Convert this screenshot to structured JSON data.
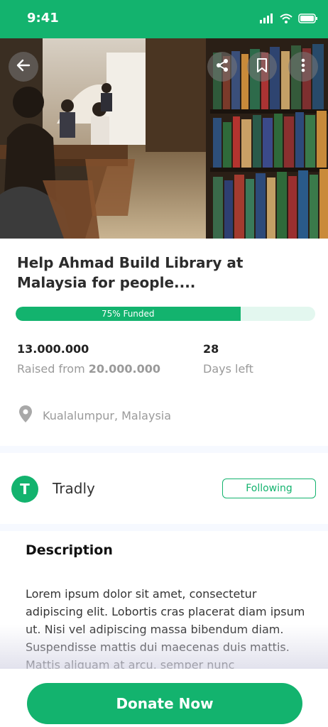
{
  "status_bar": {
    "time": "9:41"
  },
  "hero": {
    "back_icon": "arrow-left-icon",
    "share_icon": "share-icon",
    "bookmark_icon": "bookmark-icon",
    "more_icon": "more-vertical-icon"
  },
  "campaign": {
    "title": "Help Ahmad Build Library at Malaysia for people....",
    "progress_percent": 75,
    "progress_label": "75% Funded",
    "raised_amount": "13.000.000",
    "raised_from_prefix": "Raised from",
    "goal_amount": "20.000.000",
    "days_value": "28",
    "days_label": "Days left",
    "location": "Kualalumpur, Malaysia"
  },
  "seller": {
    "avatar_letter": "T",
    "name": "Tradly",
    "follow_label": "Following"
  },
  "description": {
    "heading": "Description",
    "body": "Lorem ipsum dolor sit amet, consectetur adipiscing elit. Lobortis cras placerat diam ipsum ut. Nisi vel adipiscing massa bibendum diam. Suspendisse mattis dui maecenas duis mattis. Mattis aliquam at arcu, semper nunc"
  },
  "cta": {
    "donate_label": "Donate Now"
  },
  "colors": {
    "brand_green": "#13B36E",
    "progress_track": "#E3F7EF"
  }
}
